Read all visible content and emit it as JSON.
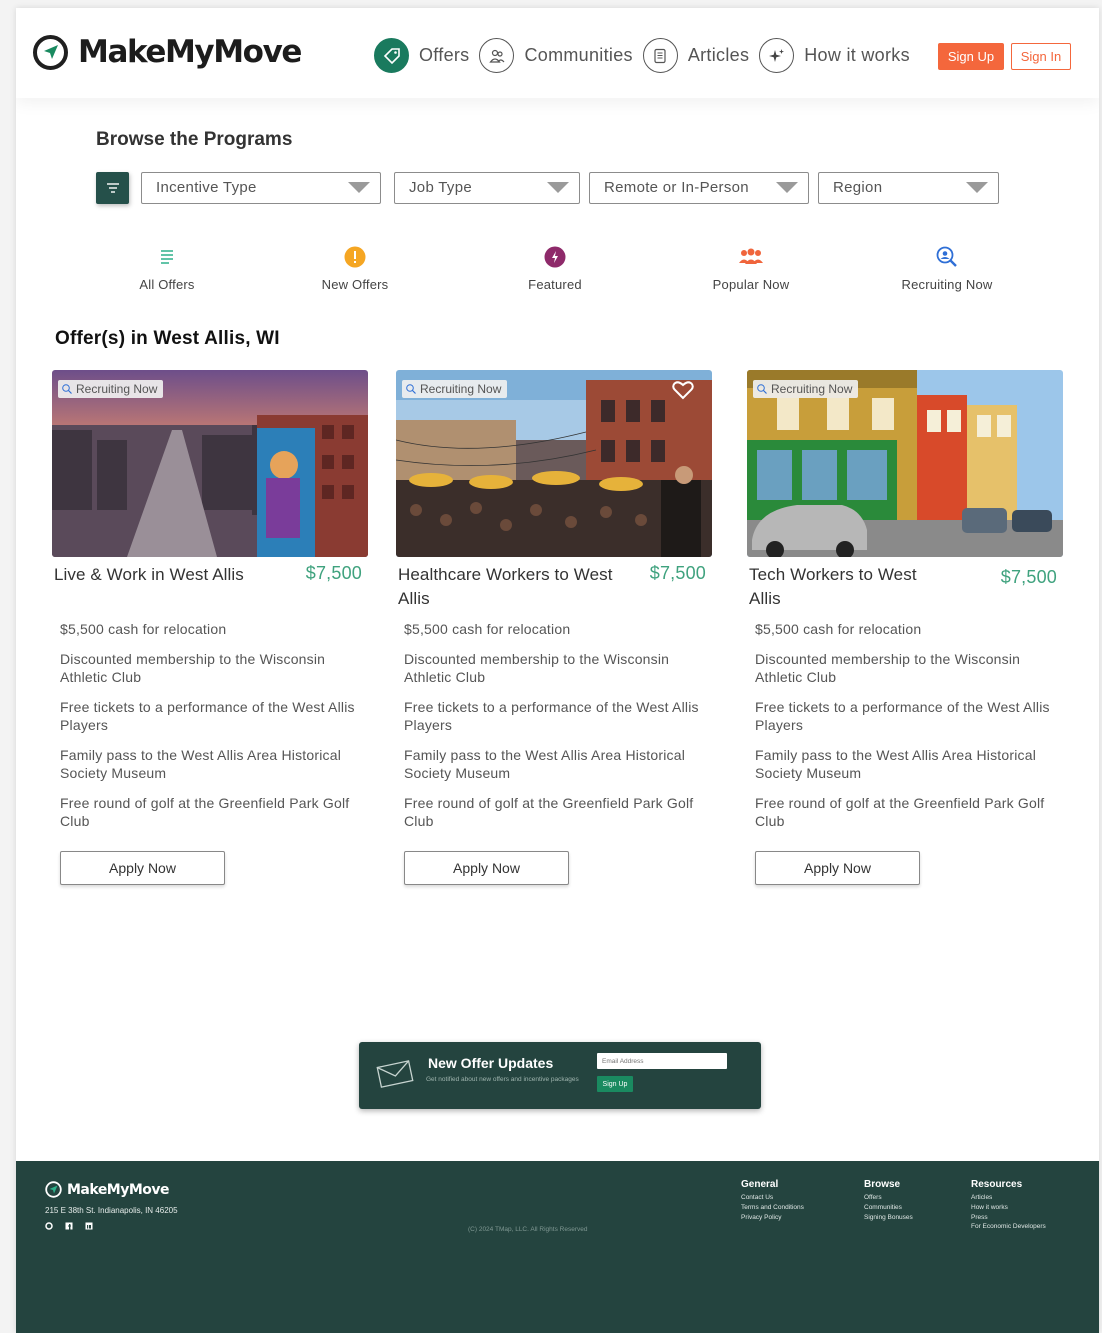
{
  "brand": {
    "name": "MakeMyMove",
    "accent": "#1a7a5e",
    "cta": "#f4673c",
    "dark": "#24443f"
  },
  "nav": {
    "items": [
      {
        "label": "Offers",
        "icon": "tag-icon",
        "active": true
      },
      {
        "label": "Communities",
        "icon": "community-icon"
      },
      {
        "label": "Articles",
        "icon": "document-icon"
      },
      {
        "label": "How it works",
        "icon": "sparkle-icon"
      }
    ],
    "sign_up": "Sign Up",
    "sign_in": "Sign In"
  },
  "browse": {
    "title": "Browse the Programs",
    "filters": [
      {
        "label": "Incentive Type"
      },
      {
        "label": "Job Type"
      },
      {
        "label": "Remote or In-Person"
      },
      {
        "label": "Region"
      }
    ]
  },
  "categories": [
    {
      "label": "All Offers",
      "icon": "list-icon"
    },
    {
      "label": "New Offers",
      "icon": "exclamation-icon"
    },
    {
      "label": "Featured",
      "icon": "lightning-icon"
    },
    {
      "label": "Popular Now",
      "icon": "group-icon"
    },
    {
      "label": "Recruiting Now",
      "icon": "user-search-icon"
    }
  ],
  "offers": {
    "section_title": "Offer(s) in West Allis, WI",
    "cards": [
      {
        "badge": "Recruiting Now",
        "title": "Live & Work in West Allis",
        "price": "$7,500",
        "perks": [
          "$5,500 cash for relocation",
          "Discounted membership to the Wisconsin Athletic Club",
          "Free tickets to a performance of the West Allis Players",
          "Family pass to the West Allis Area Historical Society Museum",
          "Free round of golf at the Greenfield Park Golf Club"
        ],
        "apply": "Apply Now"
      },
      {
        "badge": "Recruiting Now",
        "title": "Healthcare Workers to West Allis",
        "price": "$7,500",
        "perks": [
          "$5,500 cash for relocation",
          "Discounted membership to the Wisconsin Athletic Club",
          "Free tickets to a performance of the West Allis Players",
          "Family pass to the West Allis Area Historical Society Museum",
          "Free round of golf at the Greenfield Park Golf Club"
        ],
        "apply": "Apply Now"
      },
      {
        "badge": "Recruiting Now",
        "title": "Tech Workers to West Allis",
        "price": "$7,500",
        "perks": [
          "$5,500 cash for relocation",
          "Discounted membership to the Wisconsin Athletic Club",
          "Free tickets to a performance of the West Allis Players",
          "Family pass to the West Allis Area Historical Society Museum",
          "Free round of golf at the Greenfield Park Golf Club"
        ],
        "apply": "Apply Now"
      }
    ]
  },
  "newsletter": {
    "title": "New Offer Updates",
    "subtitle": "Get notified about new offers and incentive packages",
    "email_placeholder": "Email Address",
    "button": "Sign Up"
  },
  "footer": {
    "brand": "MakeMyMove",
    "address": "215 E 38th St. Indianapolis, IN 46205",
    "copyright": "(C) 2024 TMap, LLC. All Rights Reserved",
    "columns": [
      {
        "title": "General",
        "links": [
          "Contact Us",
          "Terms and Conditions",
          "Privacy Policy"
        ]
      },
      {
        "title": "Browse",
        "links": [
          "Offers",
          "Communities",
          "Signing Bonuses"
        ]
      },
      {
        "title": "Resources",
        "links": [
          "Articles",
          "How it works",
          "Press",
          "For Economic Developers"
        ]
      }
    ]
  }
}
